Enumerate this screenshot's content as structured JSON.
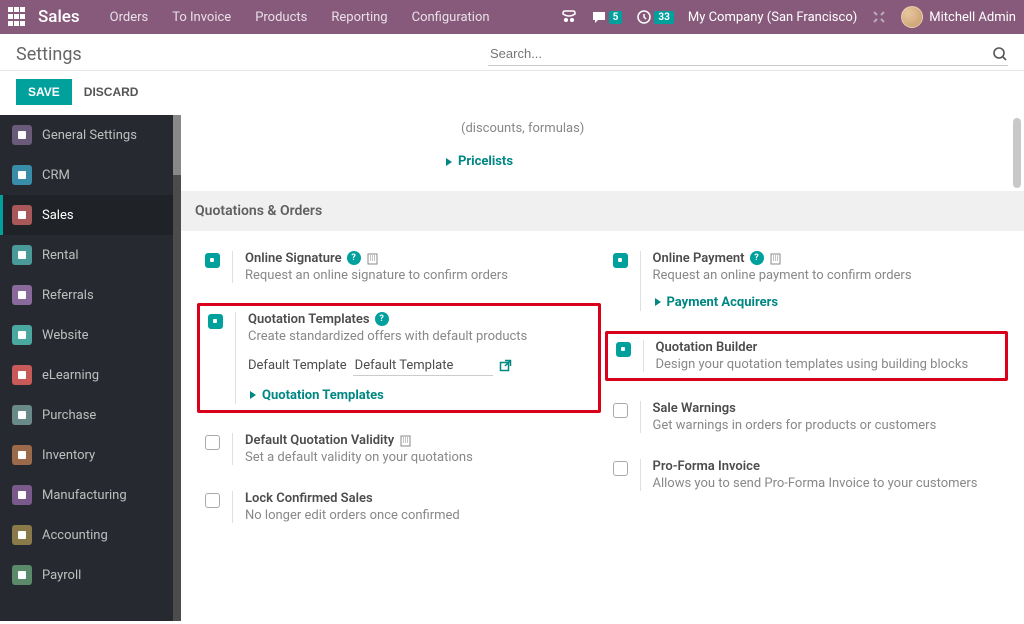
{
  "topnav": {
    "brand": "Sales",
    "menu": [
      "Orders",
      "To Invoice",
      "Products",
      "Reporting",
      "Configuration"
    ],
    "chat_badge": "5",
    "clock_badge": "33",
    "company": "My Company (San Francisco)",
    "user": "Mitchell Admin"
  },
  "header": {
    "title": "Settings",
    "search_placeholder": "Search...",
    "save": "SAVE",
    "discard": "DISCARD"
  },
  "sidebar": {
    "items": [
      {
        "label": "General Settings",
        "icon_bg": "#6b5b7b"
      },
      {
        "label": "CRM",
        "icon_bg": "#3a8da8"
      },
      {
        "label": "Sales",
        "icon_bg": "#a85858",
        "active": true
      },
      {
        "label": "Rental",
        "icon_bg": "#4a9a9a"
      },
      {
        "label": "Referrals",
        "icon_bg": "#8a6a9a"
      },
      {
        "label": "Website",
        "icon_bg": "#4aa8a0"
      },
      {
        "label": "eLearning",
        "icon_bg": "#c85a5a"
      },
      {
        "label": "Purchase",
        "icon_bg": "#6a8a8a"
      },
      {
        "label": "Inventory",
        "icon_bg": "#9a6a4a"
      },
      {
        "label": "Manufacturing",
        "icon_bg": "#7a5a8a"
      },
      {
        "label": "Accounting",
        "icon_bg": "#8a7a4a"
      },
      {
        "label": "Payroll",
        "icon_bg": "#5a8a6a"
      }
    ]
  },
  "content": {
    "sub_note": "(discounts, formulas)",
    "pricelists_link": "Pricelists",
    "section_title": "Quotations & Orders",
    "left_col": [
      {
        "title": "Online Signature",
        "desc": "Request an online signature to confirm orders",
        "checked": true,
        "help": true,
        "bldg": true
      },
      {
        "title": "Quotation Templates",
        "desc": "Create standardized offers with default products",
        "checked": true,
        "help": true,
        "highlighted": true,
        "template_label": "Default Template",
        "template_value": "Default Template",
        "sub_link": "Quotation Templates"
      },
      {
        "title": "Default Quotation Validity",
        "desc": "Set a default validity on your quotations",
        "checked": false,
        "bldg": true
      },
      {
        "title": "Lock Confirmed Sales",
        "desc": "No longer edit orders once confirmed",
        "checked": false
      }
    ],
    "right_col": [
      {
        "title": "Online Payment",
        "desc": "Request an online payment to confirm orders",
        "checked": true,
        "help": true,
        "bldg": true,
        "sub_link": "Payment Acquirers"
      },
      {
        "title": "Quotation Builder",
        "desc": "Design your quotation templates using building blocks",
        "checked": true,
        "highlighted": true
      },
      {
        "title": "Sale Warnings",
        "desc": "Get warnings in orders for products or customers",
        "checked": false
      },
      {
        "title": "Pro-Forma Invoice",
        "desc": "Allows you to send Pro-Forma Invoice to your customers",
        "checked": false
      }
    ]
  }
}
